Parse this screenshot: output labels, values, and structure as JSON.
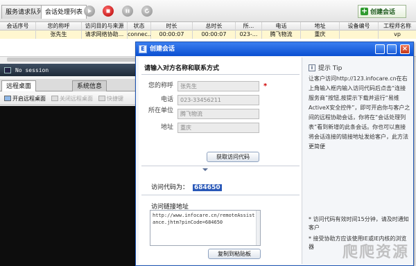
{
  "toolbar": {
    "tab_queue": "服务请求队列",
    "tab_sessions": "会话处理列表",
    "create_session": "创建会话"
  },
  "table": {
    "headers": [
      "会话序号",
      "您的称呼",
      "访问目的与来源",
      "状态",
      "时长",
      "总时长",
      "所...",
      "电话",
      "地址",
      "设备编号",
      "工程师名称"
    ],
    "row": [
      "",
      "张先生",
      "请求网络协助...",
      "connec...",
      "00:00:07",
      "00:00:07",
      "023-...",
      "腾飞物流",
      "重庆",
      "",
      "vp"
    ]
  },
  "left_panel": {
    "session_status": "No session",
    "tabs": [
      "远程桌面",
      "系统信息"
    ],
    "tools": [
      "开启远程桌面",
      "关闭远程桌面",
      "快捷键"
    ]
  },
  "dialog": {
    "title": "创建会话",
    "heading": "请输入对方名称和联系方式",
    "fields": [
      {
        "label": "您的称呼",
        "value": "张先生"
      },
      {
        "label": "电话",
        "value": "023-33456211"
      },
      {
        "label": "所在单位",
        "value": "腾飞物流"
      },
      {
        "label": "地址",
        "value": "重庆"
      }
    ],
    "get_code_button": "获取访问代码",
    "code_label": "访问代码为：",
    "code_value": "684650",
    "link_label": "访问链接地址",
    "link_value": "http://www.infocare.cn/remoteAssistance.jhtm?pinCode=684650",
    "copy_button": "复制到粘贴板",
    "tip_title": "提示 Tip",
    "tip_text": "让客户访问http://123.infocare.cn在右上角输入框内输入访问代码后点击“连接服务商”按钮,按提示下载并运行“易维ActiveX安全控件”，即可开启你与客户之间的远程协助会话，你将在“会话处理列表”看到新增的此条会话。你也可以直接将会话连接的链接地址发给客户，此方法更简便",
    "tip_note1": "* 访问代码有效时间15分钟，请及时通知客户",
    "tip_note2": "* 接受协助方应该使用IE或IE内核的浏览器"
  },
  "watermark": "爬爬资源"
}
